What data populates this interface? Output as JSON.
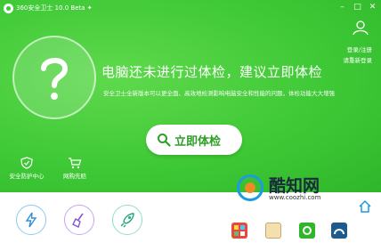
{
  "window": {
    "title": "360安全卫士 10.0 Beta ✦"
  },
  "controls": [
    "–",
    "□",
    "✕"
  ],
  "user": {
    "login_label": "登录/注册",
    "register_label": "请重新登录"
  },
  "status": {
    "headline": "电脑还未进行过体检，建议立即体检",
    "subtext": "安全卫士全新版本可以更全面、高效地检测影响电脑安全和性能的问题，体检功能大大增强"
  },
  "check_button": {
    "label": "立即体检"
  },
  "shortcuts": [
    {
      "label": "安全防护中心"
    },
    {
      "label": "网购先赔"
    }
  ],
  "watermark": {
    "name": "酷知网",
    "url": "www.coozhi.com"
  },
  "colors": {
    "brand_green": "#3fc936",
    "button_text": "#2e9e26"
  }
}
